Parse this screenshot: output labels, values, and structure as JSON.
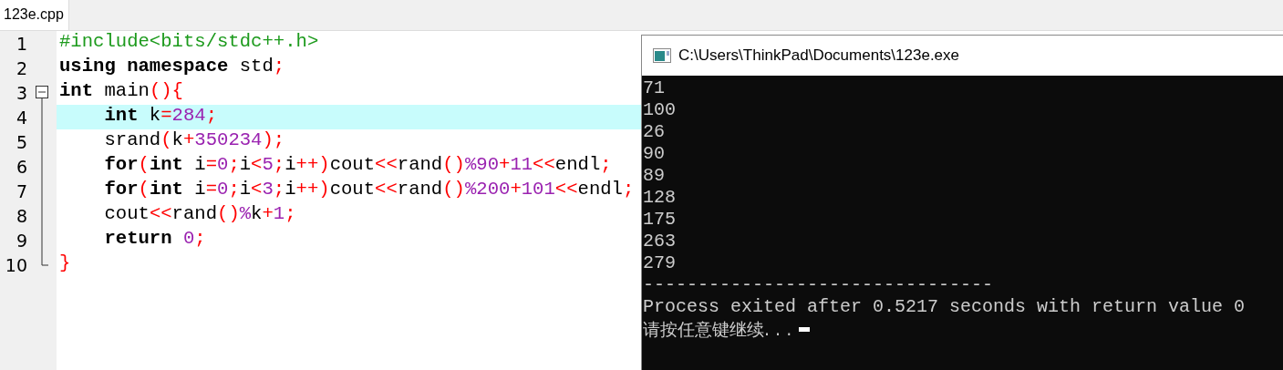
{
  "tabs": [
    {
      "label": "123e.cpp",
      "selected": true
    }
  ],
  "editor": {
    "lines": [
      {
        "number": "1",
        "fold_toggle": false,
        "fold_guide": false,
        "fold_end": false,
        "highlighted": false,
        "tokens": [
          {
            "kind": "pre",
            "text": "#include<bits/stdc++.h>"
          }
        ]
      },
      {
        "number": "2",
        "fold_toggle": false,
        "fold_guide": false,
        "fold_end": false,
        "highlighted": false,
        "tokens": [
          {
            "kind": "kw",
            "text": "using namespace"
          },
          {
            "kind": "plain",
            "text": " std"
          },
          {
            "kind": "op",
            "text": ";"
          }
        ]
      },
      {
        "number": "3",
        "fold_toggle": true,
        "fold_guide": false,
        "fold_end": false,
        "highlighted": false,
        "tokens": [
          {
            "kind": "kw",
            "text": "int"
          },
          {
            "kind": "plain",
            "text": " main"
          },
          {
            "kind": "op",
            "text": "(){"
          }
        ]
      },
      {
        "number": "4",
        "fold_toggle": false,
        "fold_guide": true,
        "fold_end": false,
        "highlighted": true,
        "tokens": [
          {
            "kind": "kw",
            "text": "    int"
          },
          {
            "kind": "plain",
            "text": " k"
          },
          {
            "kind": "op",
            "text": "="
          },
          {
            "kind": "num",
            "text": "284"
          },
          {
            "kind": "op",
            "text": ";"
          }
        ]
      },
      {
        "number": "5",
        "fold_toggle": false,
        "fold_guide": true,
        "fold_end": false,
        "highlighted": false,
        "tokens": [
          {
            "kind": "plain",
            "text": "    srand"
          },
          {
            "kind": "op",
            "text": "("
          },
          {
            "kind": "plain",
            "text": "k"
          },
          {
            "kind": "op",
            "text": "+"
          },
          {
            "kind": "num",
            "text": "350234"
          },
          {
            "kind": "op",
            "text": ");"
          }
        ]
      },
      {
        "number": "6",
        "fold_toggle": false,
        "fold_guide": true,
        "fold_end": false,
        "highlighted": false,
        "tokens": [
          {
            "kind": "kw",
            "text": "    for"
          },
          {
            "kind": "op",
            "text": "("
          },
          {
            "kind": "kw",
            "text": "int"
          },
          {
            "kind": "plain",
            "text": " i"
          },
          {
            "kind": "op",
            "text": "="
          },
          {
            "kind": "num",
            "text": "0"
          },
          {
            "kind": "op",
            "text": ";"
          },
          {
            "kind": "plain",
            "text": "i"
          },
          {
            "kind": "op",
            "text": "<"
          },
          {
            "kind": "num",
            "text": "5"
          },
          {
            "kind": "op",
            "text": ";"
          },
          {
            "kind": "plain",
            "text": "i"
          },
          {
            "kind": "op",
            "text": "++)"
          },
          {
            "kind": "plain",
            "text": "cout"
          },
          {
            "kind": "op",
            "text": "<<"
          },
          {
            "kind": "plain",
            "text": "rand"
          },
          {
            "kind": "op",
            "text": "()"
          },
          {
            "kind": "num",
            "text": "%90"
          },
          {
            "kind": "op",
            "text": "+"
          },
          {
            "kind": "num",
            "text": "11"
          },
          {
            "kind": "op",
            "text": "<<"
          },
          {
            "kind": "plain",
            "text": "endl"
          },
          {
            "kind": "op",
            "text": ";"
          }
        ]
      },
      {
        "number": "7",
        "fold_toggle": false,
        "fold_guide": true,
        "fold_end": false,
        "highlighted": false,
        "tokens": [
          {
            "kind": "kw",
            "text": "    for"
          },
          {
            "kind": "op",
            "text": "("
          },
          {
            "kind": "kw",
            "text": "int"
          },
          {
            "kind": "plain",
            "text": " i"
          },
          {
            "kind": "op",
            "text": "="
          },
          {
            "kind": "num",
            "text": "0"
          },
          {
            "kind": "op",
            "text": ";"
          },
          {
            "kind": "plain",
            "text": "i"
          },
          {
            "kind": "op",
            "text": "<"
          },
          {
            "kind": "num",
            "text": "3"
          },
          {
            "kind": "op",
            "text": ";"
          },
          {
            "kind": "plain",
            "text": "i"
          },
          {
            "kind": "op",
            "text": "++)"
          },
          {
            "kind": "plain",
            "text": "cout"
          },
          {
            "kind": "op",
            "text": "<<"
          },
          {
            "kind": "plain",
            "text": "rand"
          },
          {
            "kind": "op",
            "text": "()"
          },
          {
            "kind": "num",
            "text": "%200"
          },
          {
            "kind": "op",
            "text": "+"
          },
          {
            "kind": "num",
            "text": "101"
          },
          {
            "kind": "op",
            "text": "<<"
          },
          {
            "kind": "plain",
            "text": "endl"
          },
          {
            "kind": "op",
            "text": ";"
          }
        ]
      },
      {
        "number": "8",
        "fold_toggle": false,
        "fold_guide": true,
        "fold_end": false,
        "highlighted": false,
        "tokens": [
          {
            "kind": "plain",
            "text": "    cout"
          },
          {
            "kind": "op",
            "text": "<<"
          },
          {
            "kind": "plain",
            "text": "rand"
          },
          {
            "kind": "op",
            "text": "()"
          },
          {
            "kind": "num",
            "text": "%"
          },
          {
            "kind": "plain",
            "text": "k"
          },
          {
            "kind": "op",
            "text": "+"
          },
          {
            "kind": "num",
            "text": "1"
          },
          {
            "kind": "op",
            "text": ";"
          }
        ]
      },
      {
        "number": "9",
        "fold_toggle": false,
        "fold_guide": true,
        "fold_end": false,
        "highlighted": false,
        "tokens": [
          {
            "kind": "kw",
            "text": "    return"
          },
          {
            "kind": "num",
            "text": " 0"
          },
          {
            "kind": "op",
            "text": ";"
          }
        ]
      },
      {
        "number": "10",
        "fold_toggle": false,
        "fold_guide": false,
        "fold_end": true,
        "highlighted": false,
        "tokens": [
          {
            "kind": "op",
            "text": "}"
          }
        ]
      }
    ]
  },
  "console": {
    "title": "C:\\Users\\ThinkPad\\Documents\\123e.exe",
    "output": [
      "71",
      "100",
      "26",
      "90",
      "89",
      "128",
      "175",
      "263",
      "279"
    ],
    "separator": "--------------------------------",
    "exit_message": "Process exited after 0.5217 seconds with return value 0",
    "prompt": "请按任意键继续. . .",
    "cursor": true
  }
}
